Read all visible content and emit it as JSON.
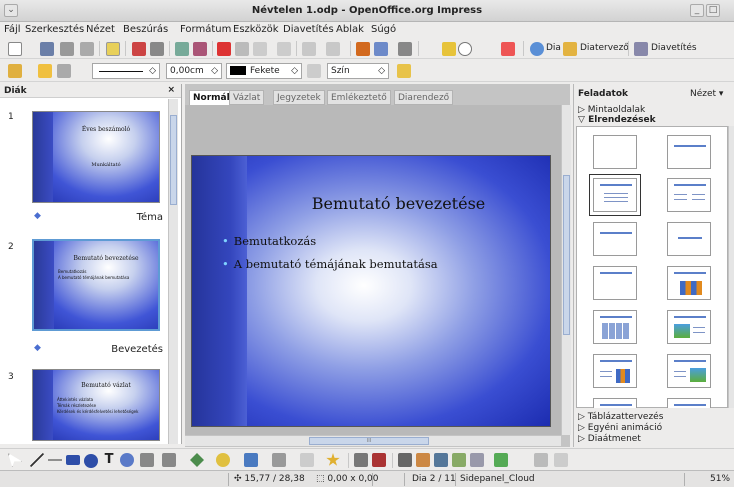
{
  "window": {
    "title": "Névtelen 1.odp - OpenOffice.org Impress"
  },
  "menu": [
    "Fájl",
    "Szerkesztés",
    "Nézet",
    "Beszúrás",
    "Formátum",
    "Eszközök",
    "Diavetítés",
    "Ablak",
    "Súgó"
  ],
  "toolbar": {
    "dia_label": "Dia",
    "diatervezo_label": "Diatervező",
    "diavetites_label": "Diavetítés"
  },
  "line_toolbar": {
    "width_value": "0,00cm",
    "color_value": "Fekete",
    "area_value": "Szín"
  },
  "slides_panel": {
    "title": "Diák",
    "slides": [
      {
        "number": "1",
        "name": "Téma",
        "title": "Éves beszámoló",
        "body": [
          "Munkáltató"
        ]
      },
      {
        "number": "2",
        "name": "Bevezetés",
        "title": "Bemutató bevezetése",
        "body": [
          "Bemutatkozás",
          "A bemutató témájának bemutatása"
        ]
      },
      {
        "number": "3",
        "name": "",
        "title": "Bemutató vázlat",
        "body": [
          "Áttekintés vázlata",
          "Témák részletezése",
          "Kérdések és kérdésfelvetési lehetőségek"
        ]
      }
    ]
  },
  "view_tabs": [
    "Normál",
    "Vázlat",
    "Jegyzetek",
    "Emlékeztető",
    "Diarendező"
  ],
  "active_tab": "Normál",
  "slide": {
    "title": "Bemutató bevezetése",
    "bullets": [
      "Bemutatkozás",
      "A bemutató témájának bemutatása"
    ]
  },
  "tasks": {
    "title": "Feladatok",
    "view_menu": "Nézet",
    "sections_top": [
      "Mintaoldalak",
      "Elrendezések"
    ],
    "sections_bottom": [
      "Táblázattervezés",
      "Egyéni animáció",
      "Diaátmenet"
    ]
  },
  "status": {
    "position": "15,77 / 28,38",
    "size": "0,00 x 0,00",
    "slide": "Dia 2 / 11",
    "layout": "Sidepanel_Cloud",
    "zoom": "51%"
  },
  "hscroll_label": "III"
}
